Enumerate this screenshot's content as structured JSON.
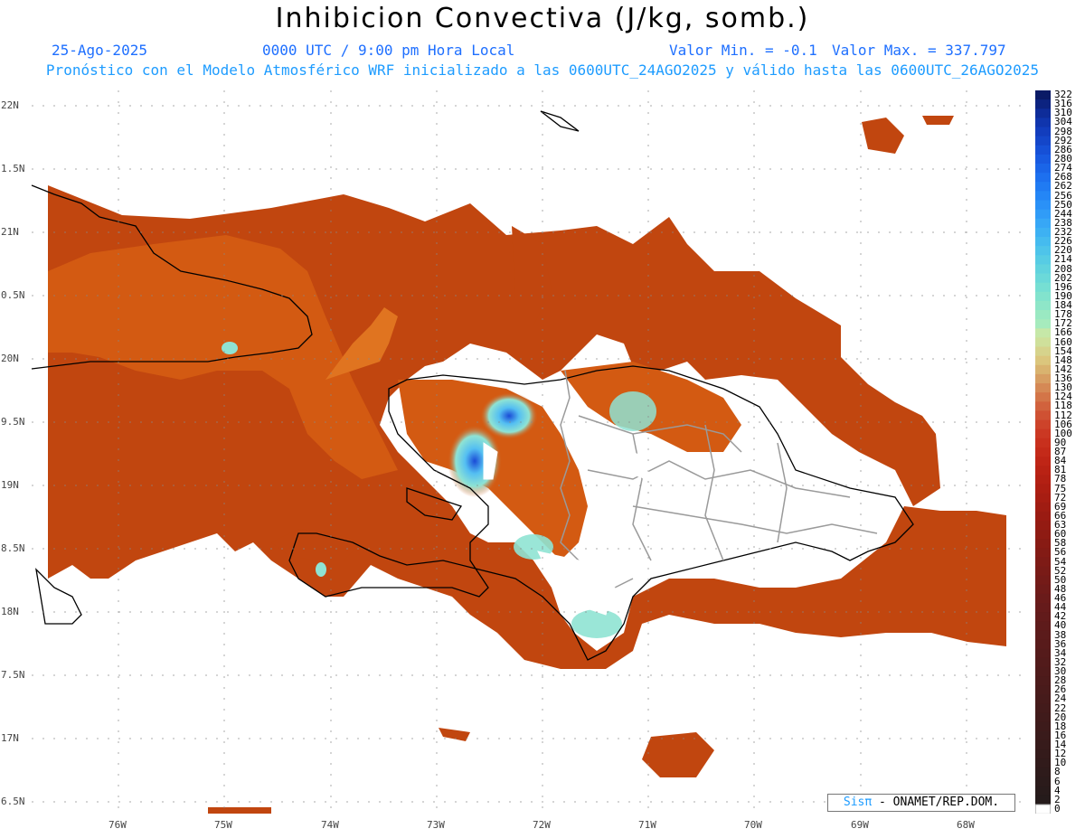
{
  "title": "Inhibicion Convectiva (J/kg, somb.)",
  "header": {
    "date": "25-Ago-2025",
    "time": "0000 UTC / 9:00 pm Hora Local",
    "valmin": "Valor Min. = -0.1",
    "valmax": "Valor Max. = 337.797",
    "subtitle": "Pronóstico con el Modelo Atmosférico WRF inicializado a las 0600UTC_24AGO2025 y válido hasta las  0600UTC_26AGO2025"
  },
  "map": {
    "lat_labels": [
      "22N",
      "1.5N",
      "21N",
      "0.5N",
      "20N",
      "9.5N",
      "19N",
      "8.5N",
      "18N",
      "7.5N",
      "17N",
      "6.5N"
    ],
    "lon_labels": [
      "76W",
      "75W",
      "74W",
      "73W",
      "72W",
      "71W",
      "70W",
      "69W",
      "68W"
    ],
    "region_colors": {
      "ocean_field": "#c1460f",
      "land_high": "#d35a12",
      "coastline": "#000000",
      "borders": "#9a9a9a",
      "cyan_patch": "#8fe3d3",
      "blue_patch": "#1a4bd6"
    }
  },
  "colorbar": {
    "labels": [
      "322",
      "316",
      "310",
      "304",
      "298",
      "292",
      "286",
      "280",
      "274",
      "268",
      "262",
      "256",
      "250",
      "244",
      "238",
      "232",
      "226",
      "220",
      "214",
      "208",
      "202",
      "196",
      "190",
      "184",
      "178",
      "172",
      "166",
      "160",
      "154",
      "148",
      "142",
      "136",
      "130",
      "124",
      "118",
      "112",
      "106",
      "100",
      "90",
      "87",
      "84",
      "81",
      "78",
      "75",
      "72",
      "69",
      "66",
      "63",
      "60",
      "58",
      "56",
      "54",
      "52",
      "50",
      "48",
      "46",
      "44",
      "42",
      "40",
      "38",
      "36",
      "34",
      "32",
      "30",
      "28",
      "26",
      "24",
      "22",
      "20",
      "18",
      "16",
      "14",
      "12",
      "10",
      "8",
      "6",
      "4",
      "2",
      "0"
    ],
    "colors": [
      "#0a1a66",
      "#0c2380",
      "#0e2c99",
      "#1035ad",
      "#123dbd",
      "#1446c9",
      "#1650d6",
      "#185ae0",
      "#1a65e8",
      "#1d70ef",
      "#207bf3",
      "#2486f6",
      "#2a91f7",
      "#309cf7",
      "#37a7f6",
      "#3db1f3",
      "#45bbef",
      "#4ec4ea",
      "#57cce4",
      "#61d3de",
      "#6bd9d9",
      "#76dfd3",
      "#82e3cd",
      "#8ee6c8",
      "#9ae9c2",
      "#a6ebbd",
      "#c6e8a8",
      "#cfe09b",
      "#d6d38c",
      "#dbc67d",
      "#d9b36f",
      "#d79e62",
      "#d58955",
      "#d37548",
      "#d1623d",
      "#cf5133",
      "#cd432a",
      "#cb3823",
      "#c8301d",
      "#c42a19",
      "#bf2516",
      "#b92214",
      "#b32013",
      "#ad1e12",
      "#a71d12",
      "#a01c12",
      "#9a1b12",
      "#941b12",
      "#8e1b13",
      "#881b14",
      "#831b15",
      "#7e1b16",
      "#791b17",
      "#741b18",
      "#6f1b19",
      "#6a1b1a",
      "#661b1b",
      "#621b1b",
      "#5e1b1b",
      "#5b1b1b",
      "#581b1b",
      "#551b1b",
      "#521b1b",
      "#4f1b1b",
      "#4c1b1b",
      "#491b1b",
      "#461b1b",
      "#431b1b",
      "#401b1b",
      "#3d1b1b",
      "#3a1b1b",
      "#371b1b",
      "#341b1b",
      "#311b1b",
      "#2e1b1b",
      "#2b1b1b",
      "#281b1b",
      "#251b1b",
      "#ffffff"
    ]
  },
  "credit": {
    "brand": "Sisπ",
    "rest": "- ONAMET/REP.DOM."
  }
}
